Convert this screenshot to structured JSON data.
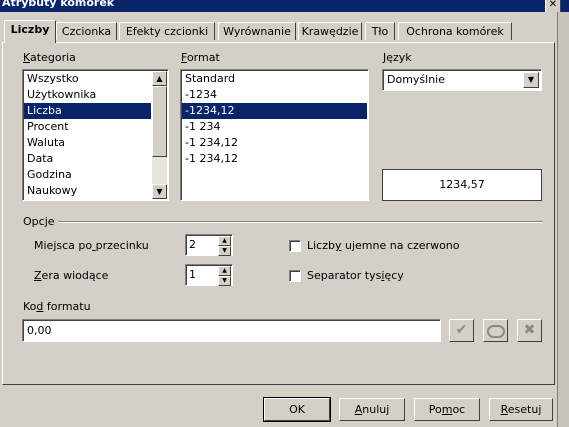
{
  "window": {
    "title": "Atrybuty komórek",
    "close_glyph": "✕"
  },
  "tabs": [
    {
      "label": "Liczby",
      "active": true
    },
    {
      "label": "Czcionka"
    },
    {
      "label": "Efekty czcionki"
    },
    {
      "label": "Wyrównanie"
    },
    {
      "label": "Krawędzie"
    },
    {
      "label": "Tło"
    },
    {
      "label": "Ochrona komórek"
    }
  ],
  "category": {
    "label": "Kategoria",
    "items": [
      "Wszystko",
      "Użytkownika",
      "Liczba",
      "Procent",
      "Waluta",
      "Data",
      "Godzina",
      "Naukowy"
    ],
    "selected": "Liczba"
  },
  "format": {
    "label": "Format",
    "items": [
      "Standard",
      "-1234",
      "-1234,12",
      "-1 234",
      "-1 234,12",
      "-1 234,12"
    ],
    "selected": "-1234,12"
  },
  "language": {
    "label": "Język",
    "value": "Domyślnie"
  },
  "preview": {
    "value": "1234,57"
  },
  "options": {
    "label": "Opcje",
    "decimal_places_label": "Miejsca po przecinku",
    "decimal_places_value": "2",
    "leading_zeros_label": "Zera wiodące",
    "leading_zeros_value": "1",
    "negative_red_label": "Liczby ujemne na czerwono",
    "negative_red_checked": false,
    "thousands_sep_label": "Separator tysięcy",
    "thousands_sep_checked": false
  },
  "format_code": {
    "label": "Kod formatu",
    "value": "0,00"
  },
  "icons": {
    "accept": {
      "name": "checkmark-icon",
      "glyph": "✔"
    },
    "comment": {
      "name": "comment-icon",
      "glyph": "💬"
    },
    "delete": {
      "name": "delete-icon",
      "glyph": "✖"
    }
  },
  "buttons": {
    "ok": "OK",
    "cancel": "Anuluj",
    "help": "Pomoc",
    "reset": "Resetuj"
  },
  "colors": {
    "selection": "#0a246a",
    "face": "#d4d0c8"
  }
}
